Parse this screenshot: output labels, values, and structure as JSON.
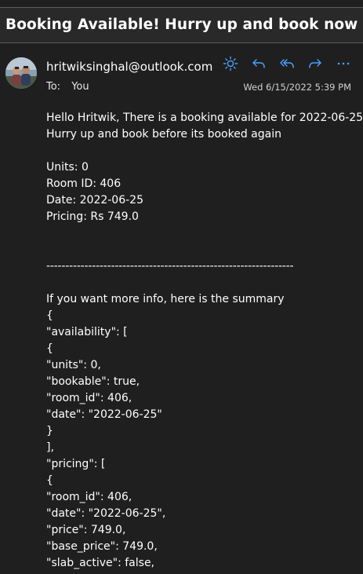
{
  "subject": "Booking Available! Hurry up and book now",
  "sender": {
    "email": "hritwiksinghal@outlook.com",
    "to_label": "To:",
    "to_value": "You",
    "date": "Wed 6/15/2022 5:39 PM"
  },
  "actions": [
    {
      "name": "brightness-icon"
    },
    {
      "name": "reply-icon"
    },
    {
      "name": "reply-all-icon"
    },
    {
      "name": "forward-icon"
    },
    {
      "name": "more-icon"
    }
  ],
  "colors": {
    "accent": "#4aa3ff",
    "background": "#1f1f1f",
    "subject_bar": "#292929"
  },
  "body": {
    "greeting_1": "Hello Hritwik, There is a booking available for 2022-06-25.",
    "greeting_2": "Hurry up and book before its booked again",
    "units": "Units: 0",
    "room_id": "Room ID: 406",
    "date": "Date: 2022-06-25",
    "pricing": "Pricing: Rs 749.0",
    "separator": "-----------------------------------------------------------------",
    "summary_intro": "If you want more info, here is the summary",
    "json_lines": [
      "{",
      "\"availability\": [",
      "{",
      "\"units\": 0,",
      "\"bookable\": true,",
      "\"room_id\": 406,",
      "\"date\": \"2022-06-25\"",
      "}",
      "],",
      "\"pricing\": [",
      "{",
      "\"room_id\": 406,",
      "\"date\": \"2022-06-25\",",
      "\"price\": 749.0,",
      "\"base_price\": 749.0,",
      "\"slab_active\": false,"
    ]
  }
}
